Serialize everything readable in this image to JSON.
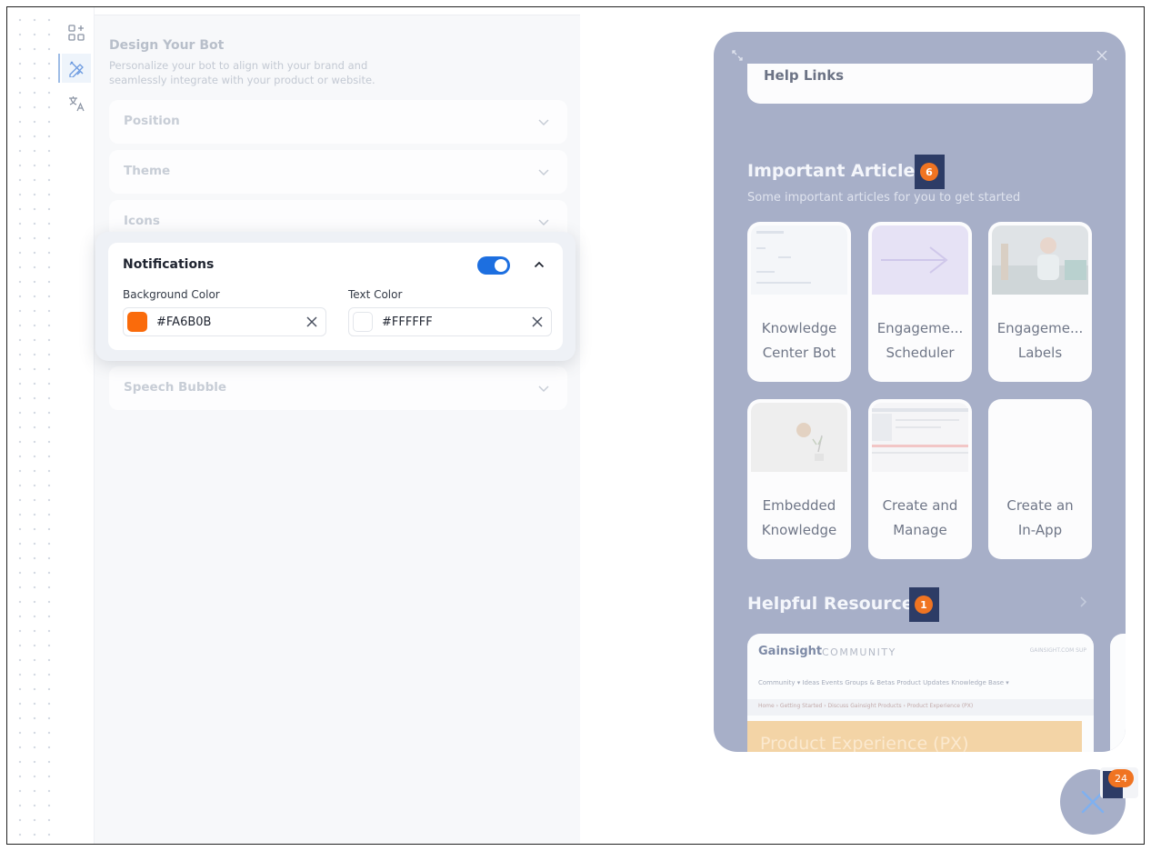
{
  "colors": {
    "accent": "#1d6fe0",
    "bot_background": "#a7afc8",
    "badge_orange": "#f07422",
    "notification_background": "#FA6B0B",
    "notification_text": "#FFFFFF"
  },
  "rail": {
    "items": [
      {
        "icon": "widgets-add-icon"
      },
      {
        "icon": "design-tools-icon",
        "active": true
      },
      {
        "icon": "translate-icon"
      }
    ]
  },
  "panel": {
    "title": "Design Your Bot",
    "subtitle": "Personalize your bot to align with your brand and seamlessly integrate with your product or website.",
    "sections": [
      {
        "label": "Position"
      },
      {
        "label": "Theme"
      },
      {
        "label": "Icons"
      },
      {
        "label": "Speech Bubble"
      }
    ],
    "notifications": {
      "title": "Notifications",
      "enabled": true,
      "background_color_label": "Background Color",
      "background_color_value": "#FA6B0B",
      "text_color_label": "Text Color",
      "text_color_value": "#FFFFFF"
    }
  },
  "bot": {
    "help_links_label": "Help Links",
    "important_articles": {
      "title": "Important Articles",
      "badge": "6",
      "subtitle": "Some important articles for you to get started",
      "articles": [
        {
          "line1": "Knowledge",
          "line2": "Center Bot"
        },
        {
          "line1": "Engageme...",
          "line2": "Scheduler"
        },
        {
          "line1": "Engageme...",
          "line2": "Labels"
        },
        {
          "line1": "Embedded",
          "line2": "Knowledge"
        },
        {
          "line1": "Create and",
          "line2": "Manage"
        },
        {
          "line1": "Create an",
          "line2": "In-App"
        }
      ]
    },
    "helpful_resources": {
      "title": "Helpful Resources",
      "badge": "1",
      "card": {
        "brand": "Gainsight",
        "brand_sub": "COMMUNITY",
        "top_right": "GAINSIGHT.COM   SUP",
        "nav": "Community ▾     Ideas     Events     Groups & Betas     Product Updates     Knowledge Base ▾",
        "breadcrumb": "Home › Getting Started › Discuss Gainsight Products › Product Experience (PX)",
        "hero": "Product Experience (PX)"
      }
    },
    "launcher_badge": "24"
  }
}
